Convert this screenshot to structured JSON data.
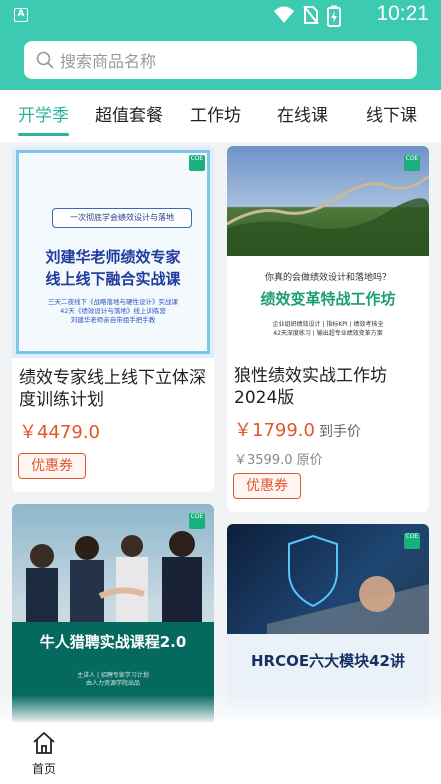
{
  "status_bar": {
    "app_badge": "A",
    "time": "10:21",
    "icons": [
      "wifi-icon",
      "no-sim-icon",
      "battery-charging-icon"
    ]
  },
  "search": {
    "placeholder": "搜索商品名称",
    "icon": "search-icon"
  },
  "tabs": [
    {
      "label": "开学季",
      "active": true
    },
    {
      "label": "超值套餐",
      "active": false
    },
    {
      "label": "工作坊",
      "active": false
    },
    {
      "label": "在线课",
      "active": false
    },
    {
      "label": "线下课",
      "active": false
    }
  ],
  "products": [
    {
      "cover": {
        "badge": "一次彻底学会绩效设计与落地",
        "headline_1": "刘建华老师绩效专家",
        "headline_2": "线上线下融合实战课",
        "lines": [
          "三天二夜线下《战略落地与硬性设计》实战课",
          "42天《绩效设计与落地》线上训练营",
          "刘建华老师亲自带组手把手教"
        ]
      },
      "title": "绩效专家线上线下立体深度训练计划",
      "price": "￥4479.0",
      "coupon": "优惠券"
    },
    {
      "cover": {
        "question": "你真的会做绩效设计和落地吗？",
        "headline": "绩效变革特战工作坊",
        "lines": [
          "企业组织绩效设计 | 指标KPI | 绩效考核全",
          "42天深度练习 | 输出超专业绩效变革方案"
        ]
      },
      "title": "狼性绩效实战工作坊2024版",
      "price": "￥1799.0",
      "price_suffix": "到手价",
      "original_price": "￥3599.0 原价",
      "coupon": "优惠券"
    },
    {
      "cover": {
        "headline": "牛人猎聘实战课程2.0",
        "lines": [
          "主讲人 | 招聘专家学习计划",
          "由人力资源学院出品"
        ]
      }
    },
    {
      "cover": {
        "headline": "HRCOE六大模块42讲"
      }
    }
  ],
  "bottom_nav": [
    {
      "label": "首页",
      "icon": "home-icon"
    }
  ],
  "colors": {
    "brand": "#3ccbb0",
    "tab_active": "#2bb59c",
    "price": "#e2572a"
  }
}
